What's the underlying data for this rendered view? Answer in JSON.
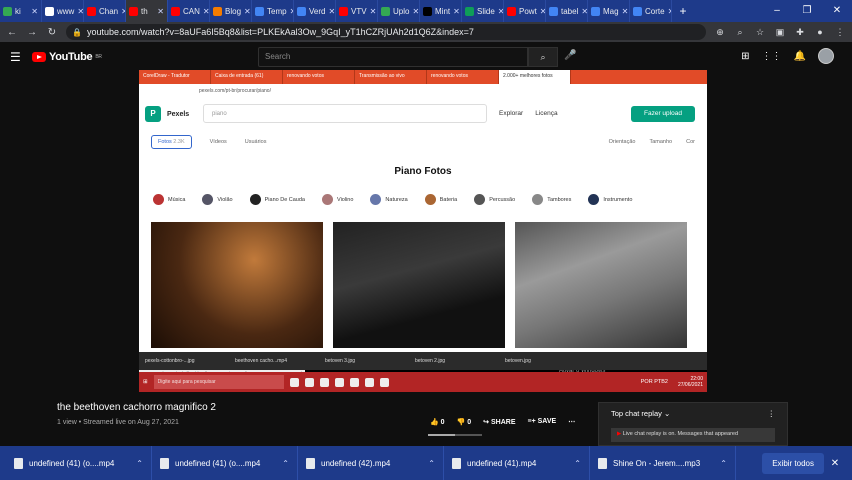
{
  "browser": {
    "tabs": [
      {
        "label": "ki",
        "color": "#34a853",
        "active": false
      },
      {
        "label": "www",
        "color": "#ffffff",
        "active": false
      },
      {
        "label": "Chan",
        "color": "#ff0000",
        "active": false
      },
      {
        "label": "th",
        "color": "#ff0000",
        "active": true
      },
      {
        "label": "CAN",
        "color": "#ff0000",
        "active": false
      },
      {
        "label": "Blog",
        "color": "#f57c00",
        "active": false
      },
      {
        "label": "Temp",
        "color": "#4285f4",
        "active": false
      },
      {
        "label": "Verd",
        "color": "#4285f4",
        "active": false
      },
      {
        "label": "VTV",
        "color": "#ff0000",
        "active": false
      },
      {
        "label": "Uplo",
        "color": "#34a853",
        "active": false
      },
      {
        "label": "Mint",
        "color": "#000000",
        "active": false
      },
      {
        "label": "Slide",
        "color": "#0f9d58",
        "active": false
      },
      {
        "label": "Powt",
        "color": "#ff0000",
        "active": false
      },
      {
        "label": "tabel",
        "color": "#4285f4",
        "active": false
      },
      {
        "label": "Mag",
        "color": "#4285f4",
        "active": false
      },
      {
        "label": "Corte",
        "color": "#4285f4",
        "active": false
      }
    ],
    "new_tab": "+",
    "url": "youtube.com/watch?v=8aUFa6I5Bq8&list=PLKEkAal3Ow_9GqI_yT1hCZRjUAh2d1Q6Z&index=7",
    "window_controls": [
      "–",
      "❐",
      "✕"
    ]
  },
  "youtube": {
    "logo": "YouTube",
    "logo_sup": "BR",
    "search_placeholder": "Search"
  },
  "embedded": {
    "tabs": [
      "CorelDraw - Tradutor",
      "Caixa de entrada (61)",
      "renovando votos",
      "Transmissão ao vivo",
      "renovando votos",
      "2.000+ melhores fotos"
    ],
    "address": "pexels.com/pt-br/procurar/piano/",
    "pexels_logo": "Pexels",
    "search_value": "piano",
    "nav": [
      "Explorar",
      "Licença"
    ],
    "upload": "Fazer upload",
    "filters": {
      "fotos": "Fotos",
      "fotos_count": "2.3K",
      "videos": "Vídeos",
      "usuarios": "Usuários"
    },
    "filters_right": [
      "Orientação",
      "Tamanho",
      "Cor"
    ],
    "page_title": "Piano Fotos",
    "categories": [
      "Música",
      "Violão",
      "Piano De Cauda",
      "Violino",
      "Natureza",
      "Bateria",
      "Percussão",
      "Tambores",
      "Instrumento"
    ],
    "status_url": "www.pexels.com/pt-br/foto/detalhe-entretenimento-diversao-programa-4088160/",
    "downloads": [
      "pexels-cottonbro-...jpg",
      "beethoven cacho...mp4",
      "betoven 3.jpg",
      "betoven 2.jpg",
      "betoven.jpg"
    ],
    "windows_watermark": "Ativar o Windows",
    "taskbar_search": "Digite aqui para pesquisar",
    "clock_time": "22:00",
    "clock_date": "27/06/2021",
    "lang": "POR PTB2"
  },
  "video": {
    "title": "the beethoven cachorro magnifico 2",
    "meta": "1 view • Streamed live on Aug 27, 2021",
    "likes": "0",
    "dislikes": "0",
    "share": "SHARE",
    "save": "SAVE",
    "like_ratio": 0.5
  },
  "chat": {
    "title": "Top chat replay",
    "message": "Live chat replay is on. Messages that appeared"
  },
  "download_shelf": {
    "items": [
      "undefined (41) (o....mp4",
      "undefined (41) (o....mp4",
      "undefined (42).mp4",
      "undefined (41).mp4",
      "Shine On - Jerem....mp3"
    ],
    "show_all": "Exibir todos"
  }
}
